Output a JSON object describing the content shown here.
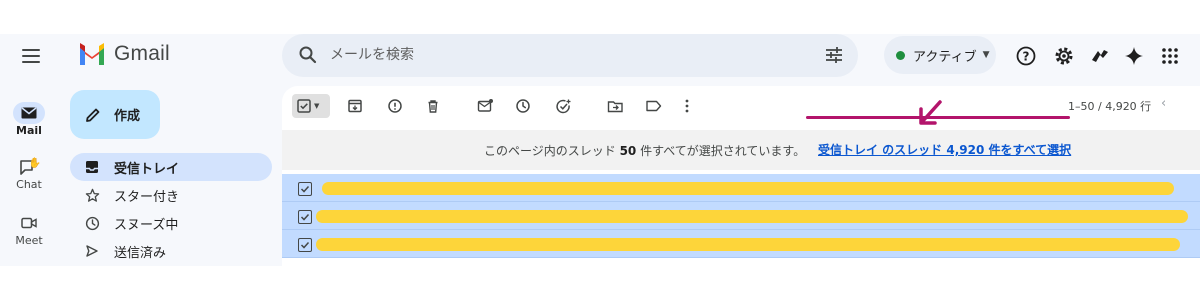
{
  "app": {
    "name": "Gmail"
  },
  "header": {
    "search_placeholder": "メールを検索",
    "status_label": "アクティブ",
    "icons": [
      "help-icon",
      "settings-icon",
      "gemini-icon",
      "spark-icon",
      "apps-icon"
    ]
  },
  "rail": {
    "items": [
      {
        "label": "Mail",
        "icon": "mail-icon",
        "active": true
      },
      {
        "label": "Chat",
        "icon": "chat-icon",
        "active": false
      },
      {
        "label": "Meet",
        "icon": "video-icon",
        "active": false
      }
    ]
  },
  "compose": {
    "label": "作成"
  },
  "sidebar": {
    "items": [
      {
        "label": "受信トレイ",
        "icon": "inbox-icon",
        "active": true
      },
      {
        "label": "スター付き",
        "icon": "star-icon",
        "active": false
      },
      {
        "label": "スヌーズ中",
        "icon": "clock-icon",
        "active": false
      },
      {
        "label": "送信済み",
        "icon": "send-icon",
        "active": false
      }
    ]
  },
  "toolbar": {
    "pager": "1–50 / 4,920 行",
    "actions": [
      "archive-icon",
      "report-spam-icon",
      "delete-icon",
      "mark-unread-icon",
      "snooze-icon",
      "add-task-icon",
      "move-to-icon",
      "label-icon",
      "more-icon"
    ]
  },
  "banner": {
    "msg_prefix": "このページ内のスレッド ",
    "msg_count": "50",
    "msg_suffix": " 件すべてが選択されています。",
    "select_all_link": "受信トレイ のスレッド 4,920 件をすべて選択"
  },
  "rows": [
    {
      "checked": true
    },
    {
      "checked": true
    },
    {
      "checked": true
    }
  ],
  "colors": {
    "accent_annotation": "#b3146b",
    "selected_row": "#c2dbff",
    "redaction": "#fdd53a"
  }
}
